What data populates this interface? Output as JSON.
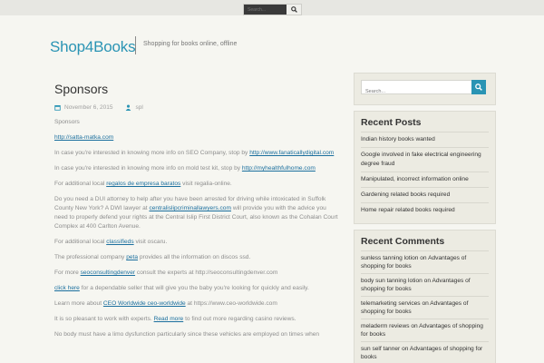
{
  "topbar": {
    "search_placeholder": "Search..."
  },
  "header": {
    "site_title": "Shop4Books",
    "tagline": "Shopping for books online, offline"
  },
  "post": {
    "title": "Sponsors",
    "date": "November 6, 2015",
    "author": "spl",
    "intro": "Sponsors",
    "p1_link": "http://satta-matka.com",
    "p2_text": "In case you're interested in knowing more info on SEO Company, stop by",
    "p2_link": "http://www.fanaticallydigital.com",
    "p3_text": "In case you're interested in knowing more info on mold test kit, stop by",
    "p3_link": "http://myhealthfulhome.com",
    "p4_pre": "For additional local",
    "p4_link": "regalos de empresa baratos",
    "p4_post": "visit regalia-online.",
    "p5_pre": "Do you need a DUI attorney to help after you have been arrested for driving while intoxicated in Suffolk County New York? A DWI lawyer at",
    "p5_link": "centralislipcriminallawyers.com",
    "p5_post": "will provide you with the advice you need to properly defend your rights at the Central Islip First District Court, also known as the Cohalan Court Complex at 400 Carlton Avenue.",
    "p6_pre": "For additional local",
    "p6_link": "classifieds",
    "p6_post": "visit oscaru.",
    "p7_pre": "The professional company",
    "p7_link": "peta",
    "p7_post": "provides all the information on discos ssd.",
    "p8_pre": "For more",
    "p8_link": "seoconsultingdenver",
    "p8_post": "consult the experts at http://seoconsultingdenver.com",
    "p9_link": "click here",
    "p9_post": "for a dependable seller that will give you the baby you're looking for quickly and easily.",
    "p10_pre": "Learn more about",
    "p10_link": "CEO Worldwide ceo-worldwide",
    "p10_post": "at https://www.ceo-worldwide.com",
    "p11_pre": "It is so pleasant to work with experts.",
    "p11_link": "Read more",
    "p11_post": "to find out more regarding casino reviews.",
    "p12_text": "No body must have a limo dysfunction particularly since these vehicles are employed on times when"
  },
  "sidebar": {
    "search_placeholder": "Search...",
    "recent_posts_title": "Recent Posts",
    "recent_posts": [
      "Indian history books wanted",
      "Google involved in fake electrical engineering degree fraud",
      "Manipulated, incorrect information online",
      "Gardening related books required",
      "Home repair related books required"
    ],
    "recent_comments_title": "Recent Comments",
    "recent_comments": [
      {
        "author": "sunless tanning lotion",
        "on": "on",
        "post": "Advantages of shopping for books"
      },
      {
        "author": "body sun tanning lotion",
        "on": "on",
        "post": "Advantages of shopping for books"
      },
      {
        "author": "telemarketing services",
        "on": "on",
        "post": "Advantages of shopping for books"
      },
      {
        "author": "meladerm reviews",
        "on": "on",
        "post": "Advantages of shopping for books"
      },
      {
        "author": "sun self tanner",
        "on": "on",
        "post": "Advantages of shopping for books"
      }
    ]
  },
  "colors": {
    "accent": "#2a94b4",
    "link": "#1b6f9e",
    "background": "#f6f6f1",
    "widget_bg": "#ecebe2"
  },
  "icons": {
    "search": "search-icon",
    "calendar": "calendar-icon",
    "user": "user-icon"
  }
}
